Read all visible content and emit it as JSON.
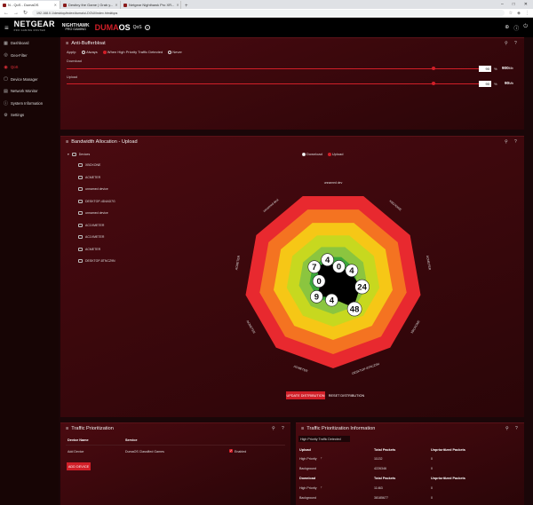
{
  "browser": {
    "tabs": [
      {
        "title": "N - QoS - DumaOS"
      },
      {
        "title": "Destiny the Game | Grab y..."
      },
      {
        "title": "Netgear Nighthawk Pro XR..."
      }
    ],
    "new_tab": "+",
    "window_controls": [
      "–",
      "□",
      "✕"
    ],
    "url": "192.168.0.1/desktop/index/duma/ui-DOUI/index.html#qos"
  },
  "header": {
    "brand": "NETGEAR",
    "brand_tagline": "PRO GAMING ROUTER",
    "nighthawk": "NIGHTHAWK",
    "nighthawk_sub": "PRO GAMING",
    "os_name_a": "DUMA",
    "os_name_b": "OS",
    "breadcrumb": "QoS",
    "help": "?"
  },
  "sidebar": {
    "items": [
      {
        "label": "Dashboard",
        "icon": "dashboard-icon",
        "glyph": "▦"
      },
      {
        "label": "Geo-Filter",
        "icon": "globe-icon",
        "glyph": "◎"
      },
      {
        "label": "QoS",
        "icon": "qos-icon",
        "glyph": "◉"
      },
      {
        "label": "Device Manager",
        "icon": "devices-icon",
        "glyph": "▢"
      },
      {
        "label": "Network Monitor",
        "icon": "monitor-icon",
        "glyph": "▤"
      },
      {
        "label": "System Information",
        "icon": "info-icon",
        "glyph": "ⓘ"
      },
      {
        "label": "Settings",
        "icon": "gear-icon",
        "glyph": "⚙"
      }
    ]
  },
  "anti_bufferbloat": {
    "title": "Anti-Bufferbloat",
    "apply_label": "Apply:",
    "options": [
      "Always",
      "When High Priority Traffic Detected",
      "Never"
    ],
    "selected": "When High Priority Traffic Detected",
    "download_label": "Download",
    "download_value": "90",
    "download_mbps": "900",
    "upload_label": "Upload",
    "upload_value": "90",
    "upload_mbps": "90",
    "percent": "%",
    "mb_unit": "Mb",
    "slider_level": 0.9
  },
  "bandwidth": {
    "title": "Bandwidth Allocation - Upload",
    "devices_header": "Devices",
    "toggle": {
      "download": "Download",
      "upload": "Upload",
      "selected": "Upload"
    },
    "devices": [
      "XBOXONE",
      "ACMETER",
      "unnamed device",
      "DESKTOP-4D4AD7G",
      "unnamed device",
      "AC1VMETER",
      "AC1VMETER",
      "ACMETER",
      "DESKTOP-8TNCZ9N"
    ],
    "wheel_labels": [
      "unnamed dev",
      "XBOXONE",
      "ACMETER",
      "XBOXONE",
      "DESKTOP-8TNCZ9N",
      "ACMETER",
      "ACMETER",
      "ACMETER",
      "unnamed devi"
    ],
    "allocations": [
      4,
      0,
      4,
      24,
      48,
      4,
      9,
      0,
      7
    ],
    "update_btn": "UPDATE DISTRIBUTION",
    "reset_btn": "RESET DISTRIBUTION",
    "ring_colors": [
      "#e8292f",
      "#f47321",
      "#f6c716",
      "#c7d81f",
      "#8bc53f",
      "#3aa63a"
    ]
  },
  "traffic_prio": {
    "title": "Traffic Prioritization",
    "col_device": "Device Name",
    "col_service": "Service",
    "row_device": "Add Device",
    "row_service": "DumaOS Classified Games",
    "enabled": "Enabled",
    "add_btn": "ADD DEVICE"
  },
  "traffic_info": {
    "title": "Traffic Prioritization Information",
    "status": "High Priority Traffic Detected",
    "upload_header": "Upload",
    "download_header": "Download",
    "col_total": "Total Packets",
    "col_unprio": "Unprioritized Packets",
    "upload_rows": [
      {
        "name": "High Priority",
        "total": "11132",
        "unprio": "0",
        "arrow": "↑"
      },
      {
        "name": "Background",
        "total": "4226346",
        "unprio": "0",
        "arrow": ""
      }
    ],
    "download_rows": [
      {
        "name": "High Priority",
        "total": "11463",
        "unprio": "0",
        "arrow": "↑"
      },
      {
        "name": "Background",
        "total": "38185677",
        "unprio": "0",
        "arrow": ""
      }
    ]
  }
}
